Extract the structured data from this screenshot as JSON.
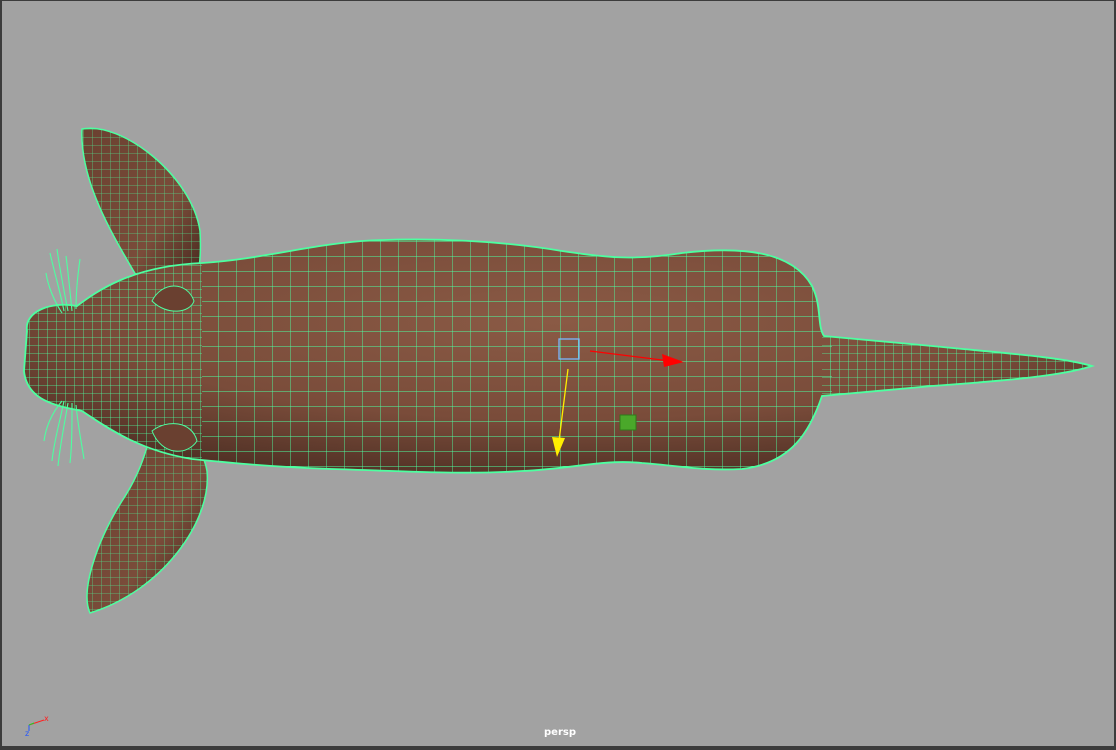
{
  "viewport": {
    "camera_label": "persp"
  },
  "axis_gizmo": {
    "x_label": "x",
    "z_label": "z"
  },
  "colors": {
    "background": "#a2a2a2",
    "mesh_fill": "#7a4c3a",
    "wireframe": "#4dffa0",
    "x_axis": "#ff0000",
    "y_axis": "#ffee00",
    "center_handle": "#7ab8ff",
    "pivot_square": "#4aa82a"
  },
  "icons": {
    "manipulator": "move-tool-manipulator-icon",
    "axis": "view-axis-icon"
  }
}
